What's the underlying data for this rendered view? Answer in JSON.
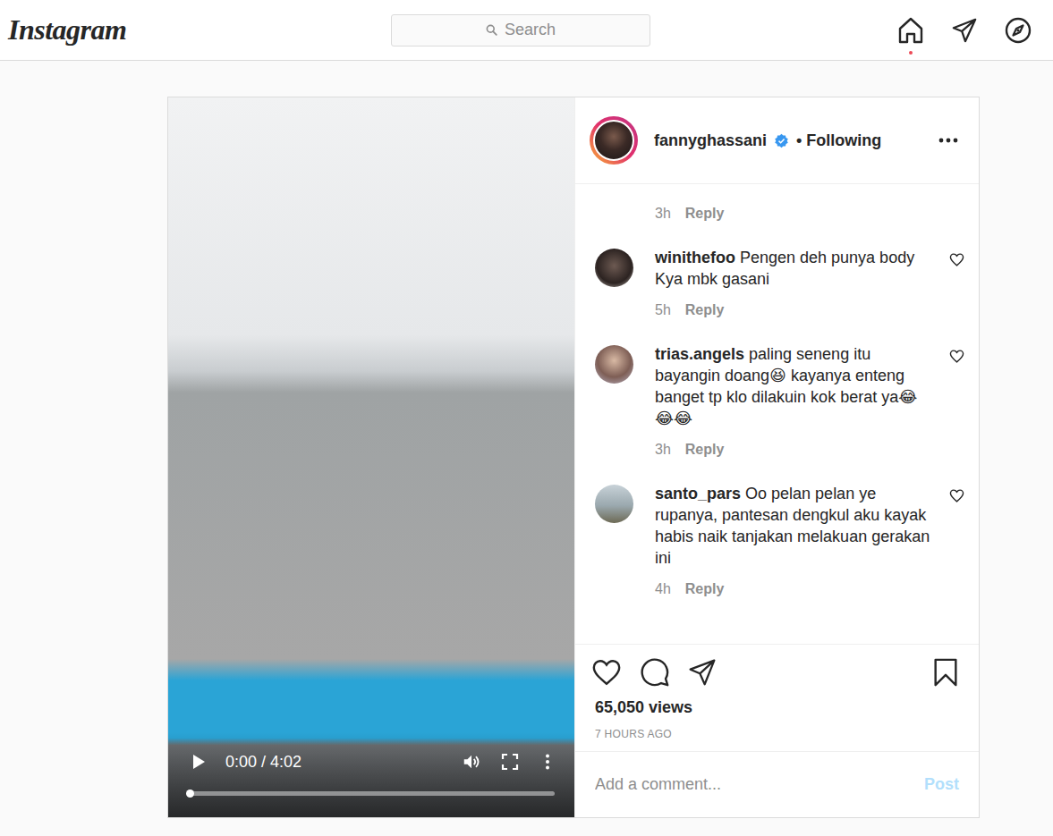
{
  "nav": {
    "logo": "Instagram",
    "search": {
      "placeholder": "Search"
    },
    "home_notification": true
  },
  "post": {
    "video": {
      "time": "0:00 / 4:02",
      "playing": false,
      "progress": {
        "level": 0
      }
    },
    "author": {
      "username": "fannyghassani",
      "verified": true,
      "follow_label": "• Following"
    },
    "cut_comment": {
      "time": "3h",
      "reply": "Reply"
    },
    "comments": [
      {
        "user": "winithefoo",
        "text": "Pengen deh punya body Kya mbk gasani",
        "time": "5h",
        "reply": "Reply",
        "liked": false
      },
      {
        "user": "trias.angels",
        "text": "paling seneng itu bayangin doang😆 kayanya enteng banget tp klo dilakuin kok berat ya😂😂😂",
        "time": "3h",
        "reply": "Reply",
        "liked": false
      },
      {
        "user": "santo_pars",
        "text": "Oo pelan pelan ye rupanya, pantesan dengkul aku kayak habis naik tanjakan melakuan gerakan ini",
        "time": "4h",
        "reply": "Reply",
        "liked": false
      }
    ],
    "liked": false,
    "saved": false,
    "views": "65,050 views",
    "posted": "7 HOURS AGO",
    "add_comment": {
      "placeholder": "Add a comment...",
      "button": "Post",
      "disabled": true
    }
  }
}
